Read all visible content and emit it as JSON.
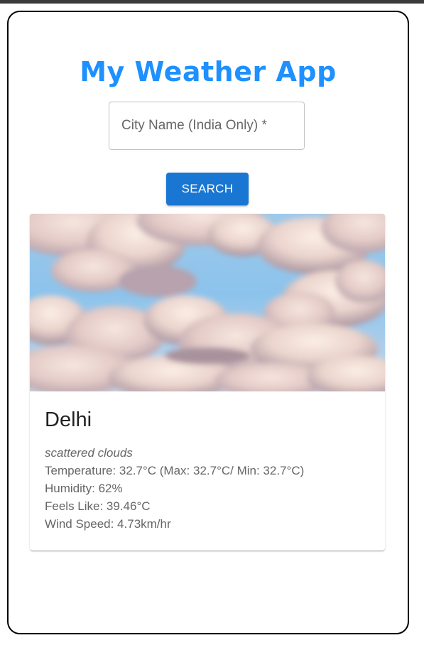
{
  "app": {
    "title": "My Weather App"
  },
  "search": {
    "placeholder": "City Name (India Only) *",
    "value": "",
    "button_label": "SEARCH"
  },
  "weather": {
    "city": "Delhi",
    "description": "scattered clouds",
    "temperature_line": "Temperature: 32.7°C (Max: 32.7°C/ Min: 32.7°C)",
    "humidity_line": "Humidity: 62%",
    "feels_like_line": "Feels Like: 39.46°C",
    "wind_line": "Wind Speed: 4.73km/hr",
    "image_icon": "cloudy-sky-image"
  },
  "colors": {
    "title": "#1e90ff",
    "button": "#1976d2",
    "frame_border": "#000000",
    "top_strip": "#3a3a3a"
  }
}
